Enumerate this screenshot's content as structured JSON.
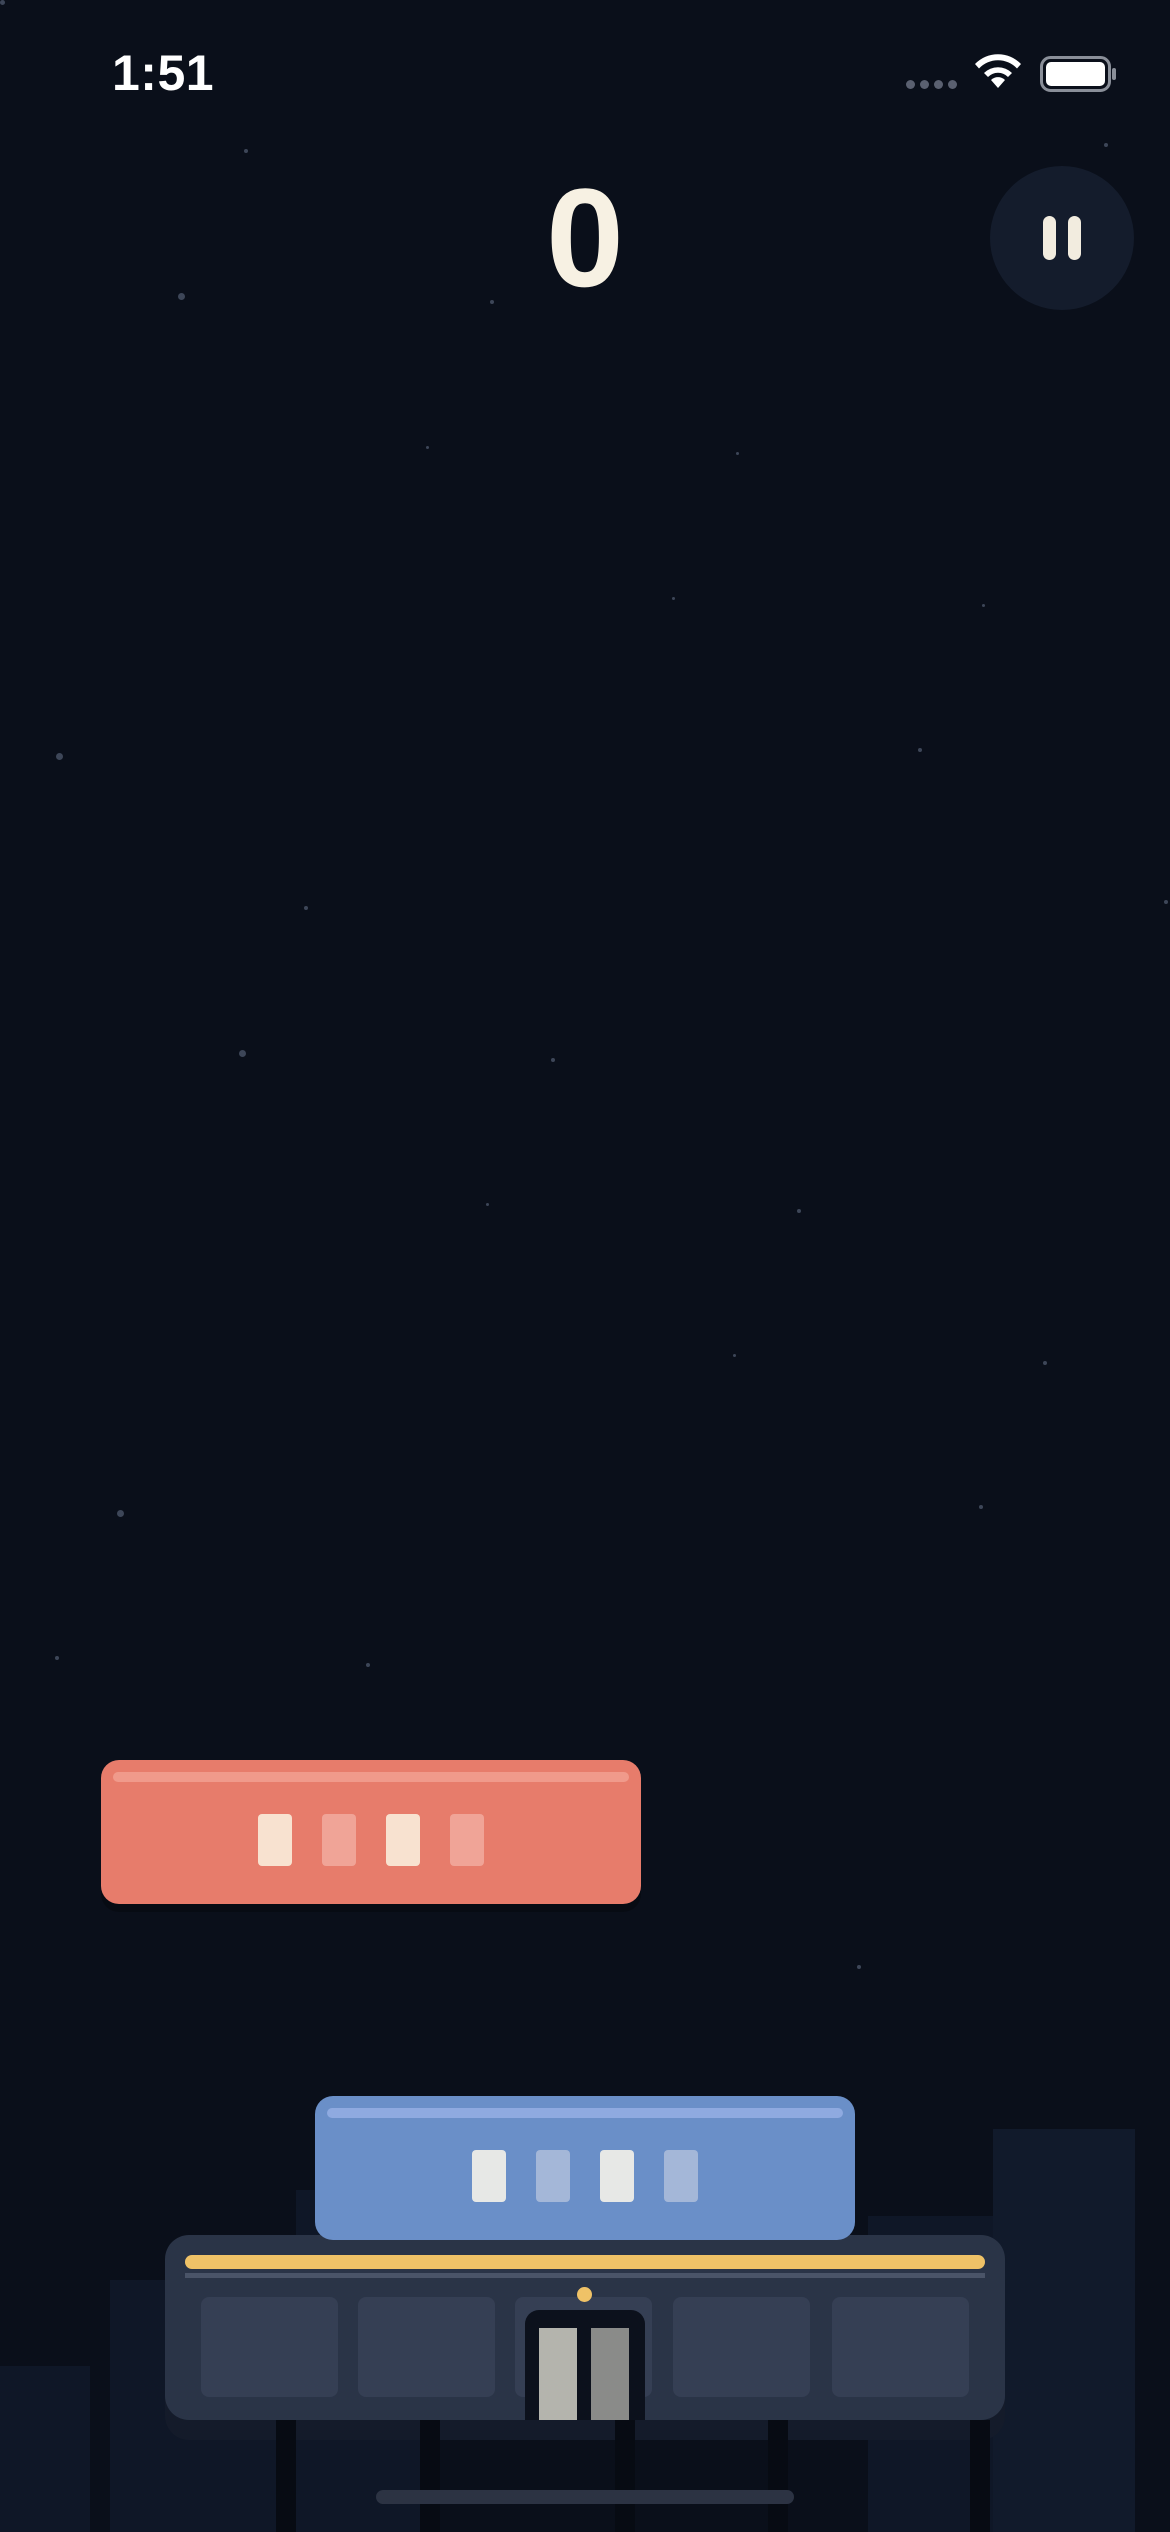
{
  "status_bar": {
    "time": "1:51",
    "icons": [
      "cellular-signal-icon",
      "wifi-icon",
      "battery-icon"
    ]
  },
  "game": {
    "score": "0",
    "pause_icon": "pause-icon"
  },
  "colors": {
    "background": "#0a0f1a",
    "score_text": "#f7f1e3",
    "swinging_block": "#e77c6b",
    "stacked_block": "#6a8fc8",
    "base": "#2a3447",
    "accent_stripe": "#efc267"
  }
}
